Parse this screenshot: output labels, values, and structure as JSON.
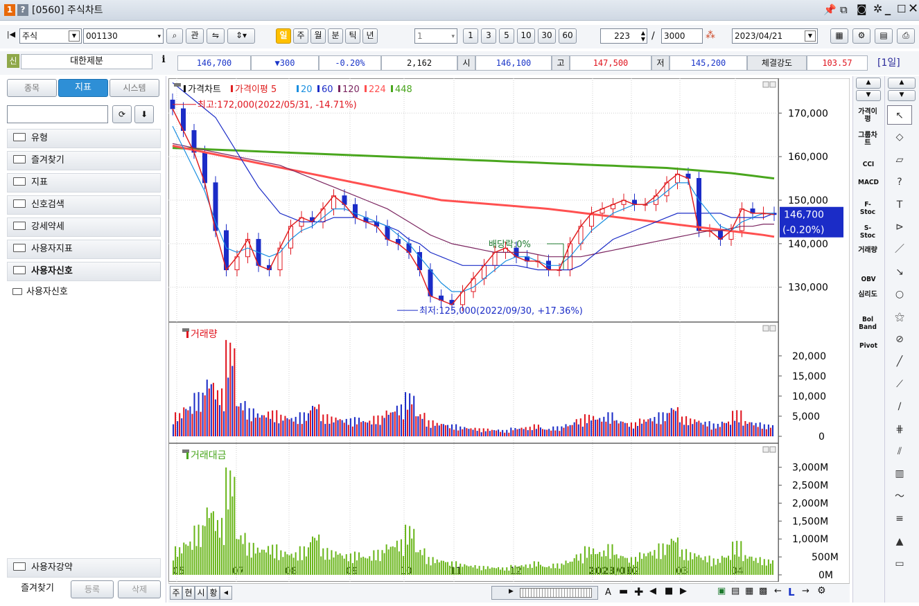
{
  "window": {
    "badge_num": "1",
    "badge_help": "?",
    "title": "[0560] 주식차트",
    "controls": [
      "pin-icon",
      "copy-icon",
      "camera-icon",
      "settings-icon",
      "minimize-icon",
      "maximize-icon",
      "close-icon"
    ]
  },
  "toolbar": {
    "market": "주식",
    "code": "001130",
    "watch_label": "관",
    "periods": [
      "일",
      "주",
      "월",
      "분",
      "틱",
      "년"
    ],
    "active_period": "일",
    "interval": "1",
    "interval_buttons": [
      "1",
      "3",
      "5",
      "10",
      "30",
      "60"
    ],
    "count": "223",
    "total": "3000",
    "date": "2023/04/21"
  },
  "quote": {
    "badge": "신",
    "name": "대한제분",
    "price": "146,700",
    "change": "▼300",
    "change_pct": "-0.20%",
    "volume": "2,162",
    "open_label": "시",
    "open": "146,100",
    "high_label": "고",
    "high": "147,500",
    "low_label": "저",
    "low": "145,200",
    "strength_label": "체결강도",
    "strength": "103.57",
    "period_label": "[1일]"
  },
  "sidebar": {
    "tabs": [
      "종목",
      "지표",
      "시스템"
    ],
    "active_tab": "지표",
    "folders": [
      "유형",
      "즐겨찾기",
      "지표",
      "신호검색",
      "강세약세",
      "사용자지표",
      "사용자신호"
    ],
    "sub_item": "사용자신호",
    "bottom_folder": "사용자강약",
    "footer": [
      "즐겨찾기",
      "등록",
      "삭제"
    ]
  },
  "right_panel": {
    "indicators": [
      "가격이평",
      "그룹차트",
      "CCI",
      "MACD",
      "F-Stoc",
      "S-Stoc",
      "거래량",
      "OBV",
      "심리도",
      "Bol Band",
      "Pivot"
    ],
    "tools": [
      "cursor-tool-icon",
      "eraser-tool-icon",
      "all-delete-icon",
      "help-tool-icon",
      "text-tool-icon",
      "fill-tool-icon",
      "line-tool-icon",
      "angle-line-icon",
      "circle-tool-icon",
      "pattern-tool-icon",
      "parallel-line-icon",
      "gann-tool-icon",
      "fan-tool-icon",
      "channel-tool-icon",
      "bar-tool-icon",
      "pitchfork-icon",
      "grid-tool-icon",
      "wave-tool-icon",
      "fibonacci-icon",
      "auto-trend-icon",
      "window-tool-icon"
    ]
  },
  "bottom_bar": {
    "tabs": [
      "주",
      "현",
      "시",
      "황"
    ],
    "letters": [
      "A",
      "L"
    ]
  },
  "chart_data": [
    {
      "type": "candlestick",
      "title": "가격차트",
      "legend": [
        {
          "name": "가격차트",
          "color": "#111111"
        },
        {
          "name": "가격이평 5",
          "color": "#e02020"
        },
        {
          "name": "20",
          "color": "#1a8fe0"
        },
        {
          "name": "60",
          "color": "#1b2cc7"
        },
        {
          "name": "120",
          "color": "#7b2560"
        },
        {
          "name": "224",
          "color": "#ff5050"
        },
        {
          "name": "448",
          "color": "#49a61d"
        }
      ],
      "x_ticks": [
        "05",
        "07",
        "08",
        "09",
        "10",
        "11",
        "12",
        "2023/01",
        "02",
        "03",
        "04"
      ],
      "y_ticks": [
        130000,
        140000,
        150000,
        160000,
        170000
      ],
      "ylim": [
        122000,
        178000
      ],
      "close": [
        171000,
        166000,
        161000,
        154000,
        143000,
        134000,
        137000,
        141000,
        135000,
        134000,
        139000,
        144000,
        146000,
        145000,
        148000,
        151000,
        149000,
        146000,
        145000,
        144000,
        141000,
        140000,
        138000,
        134000,
        128000,
        127000,
        126000,
        129000,
        132000,
        135000,
        138000,
        139000,
        137000,
        136000,
        136000,
        134000,
        134000,
        140000,
        144000,
        147000,
        148000,
        149000,
        150000,
        149000,
        149000,
        151000,
        154000,
        156000,
        155000,
        143000,
        143000,
        141000,
        143000,
        148000,
        147000,
        147000,
        146700
      ],
      "ma20": [
        167000,
        162000,
        157000,
        152000,
        145000,
        139000,
        138000,
        139000,
        138000,
        137000,
        138000,
        141000,
        143000,
        144000,
        146000,
        148000,
        148000,
        147000,
        146000,
        145000,
        144000,
        142000,
        140000,
        137000,
        134000,
        131000,
        129000,
        129000,
        130000,
        132000,
        134000,
        136000,
        137000,
        137000,
        136000,
        135000,
        135000,
        137000,
        140000,
        143000,
        145000,
        147000,
        148000,
        149000,
        149000,
        150000,
        152000,
        154000,
        154000,
        150000,
        147000,
        144000,
        143000,
        145000,
        146000,
        147000,
        147000
      ],
      "ma60": [
        177000,
        175000,
        173000,
        171000,
        169000,
        165000,
        161000,
        157000,
        153000,
        150000,
        147000,
        146000,
        145000,
        145000,
        145000,
        146000,
        146000,
        146000,
        145000,
        145000,
        144000,
        143000,
        141000,
        140000,
        138000,
        137000,
        136000,
        135000,
        135000,
        135000,
        135000,
        135000,
        135000,
        134500,
        134000,
        134000,
        134000,
        134000,
        135000,
        137000,
        139000,
        141000,
        142000,
        143000,
        144000,
        145000,
        146000,
        147000,
        147000,
        147000,
        147000,
        147000,
        146000,
        146000,
        146000,
        146000,
        147000
      ],
      "ma120": [
        163000,
        162500,
        162000,
        161500,
        161000,
        160500,
        160000,
        159500,
        159000,
        158500,
        158000,
        157000,
        156000,
        155000,
        154000,
        153000,
        152000,
        151000,
        150000,
        149000,
        148000,
        146500,
        145000,
        143500,
        142000,
        141000,
        140000,
        139500,
        139000,
        138500,
        138000,
        138000,
        138000,
        138000,
        137500,
        137000,
        137000,
        137000,
        137000,
        137500,
        138000,
        138500,
        139000,
        139500,
        140000,
        140500,
        141000,
        141500,
        142000,
        142500,
        143000,
        143000,
        143500,
        144000,
        144000,
        144500,
        144500
      ],
      "ma224": [
        162500,
        162000,
        161500,
        161000,
        160500,
        160000,
        159500,
        159000,
        158500,
        158000,
        157500,
        157000,
        156500,
        156000,
        155500,
        155000,
        154500,
        154000,
        153500,
        153000,
        152500,
        152000,
        151500,
        151000,
        150500,
        150000,
        149800,
        149600,
        149400,
        149200,
        149000,
        148800,
        148600,
        148400,
        148200,
        148000,
        147700,
        147400,
        147100,
        146800,
        146500,
        146200,
        145900,
        145600,
        145300,
        145000,
        144700,
        144400,
        144100,
        143800,
        143500,
        143200,
        142900,
        142600,
        142300,
        142000,
        141600
      ],
      "ma448": [
        162000,
        161900,
        161800,
        161700,
        161600,
        161500,
        161400,
        161300,
        161200,
        161100,
        161000,
        160900,
        160800,
        160700,
        160600,
        160500,
        160400,
        160300,
        160200,
        160100,
        160000,
        159900,
        159800,
        159700,
        159600,
        159500,
        159400,
        159300,
        159200,
        159100,
        159000,
        158900,
        158800,
        158700,
        158600,
        158500,
        158400,
        158300,
        158200,
        158100,
        158000,
        157900,
        157800,
        157700,
        157600,
        157500,
        157400,
        157200,
        157000,
        156800,
        156600,
        156400,
        156200,
        155900,
        155600,
        155300,
        155000
      ],
      "annotations": {
        "high": "최고:172,000(2022/05/31, -14.71%)",
        "low": "최저:125,000(2022/09/30, +17.36%)",
        "dividend": "배당락:0%"
      },
      "price_label": "146,700",
      "price_pct": "(-0.20%)"
    },
    {
      "type": "bar",
      "title": "거래량",
      "y_ticks": [
        "0",
        "5,000",
        "10,000",
        "15,000",
        "20,000"
      ],
      "ylim": [
        0,
        26000
      ],
      "values": [
        6000,
        8000,
        11000,
        15000,
        12000,
        24000,
        9000,
        7000,
        6000,
        6500,
        5500,
        5000,
        6000,
        8500,
        5500,
        5000,
        4500,
        4800,
        4200,
        5200,
        6800,
        8000,
        11000,
        6000,
        4000,
        3500,
        3000,
        2500,
        2200,
        2000,
        1800,
        1600,
        2200,
        2400,
        3000,
        2000,
        2500,
        3200,
        4500,
        5500,
        5000,
        6000,
        4200,
        3500,
        4500,
        5000,
        6000,
        7800,
        5000,
        4500,
        3800,
        3200,
        4000,
        6500,
        4000,
        3500,
        3000
      ]
    },
    {
      "type": "bar",
      "title": "거래대금",
      "y_ticks": [
        "0M",
        "500M",
        "1,000M",
        "1,500M",
        "2,000M",
        "2,500M",
        "3,000M"
      ],
      "ylim": [
        0,
        3400
      ],
      "values": [
        800,
        1000,
        1400,
        2000,
        1600,
        3000,
        1200,
        900,
        800,
        850,
        700,
        650,
        800,
        1200,
        750,
        700,
        600,
        650,
        560,
        700,
        900,
        1000,
        1400,
        760,
        500,
        450,
        380,
        320,
        280,
        250,
        230,
        210,
        280,
        300,
        380,
        260,
        320,
        420,
        600,
        800,
        700,
        860,
        600,
        500,
        640,
        720,
        880,
        1120,
        720,
        640,
        540,
        460,
        580,
        950,
        580,
        500,
        440
      ]
    }
  ]
}
